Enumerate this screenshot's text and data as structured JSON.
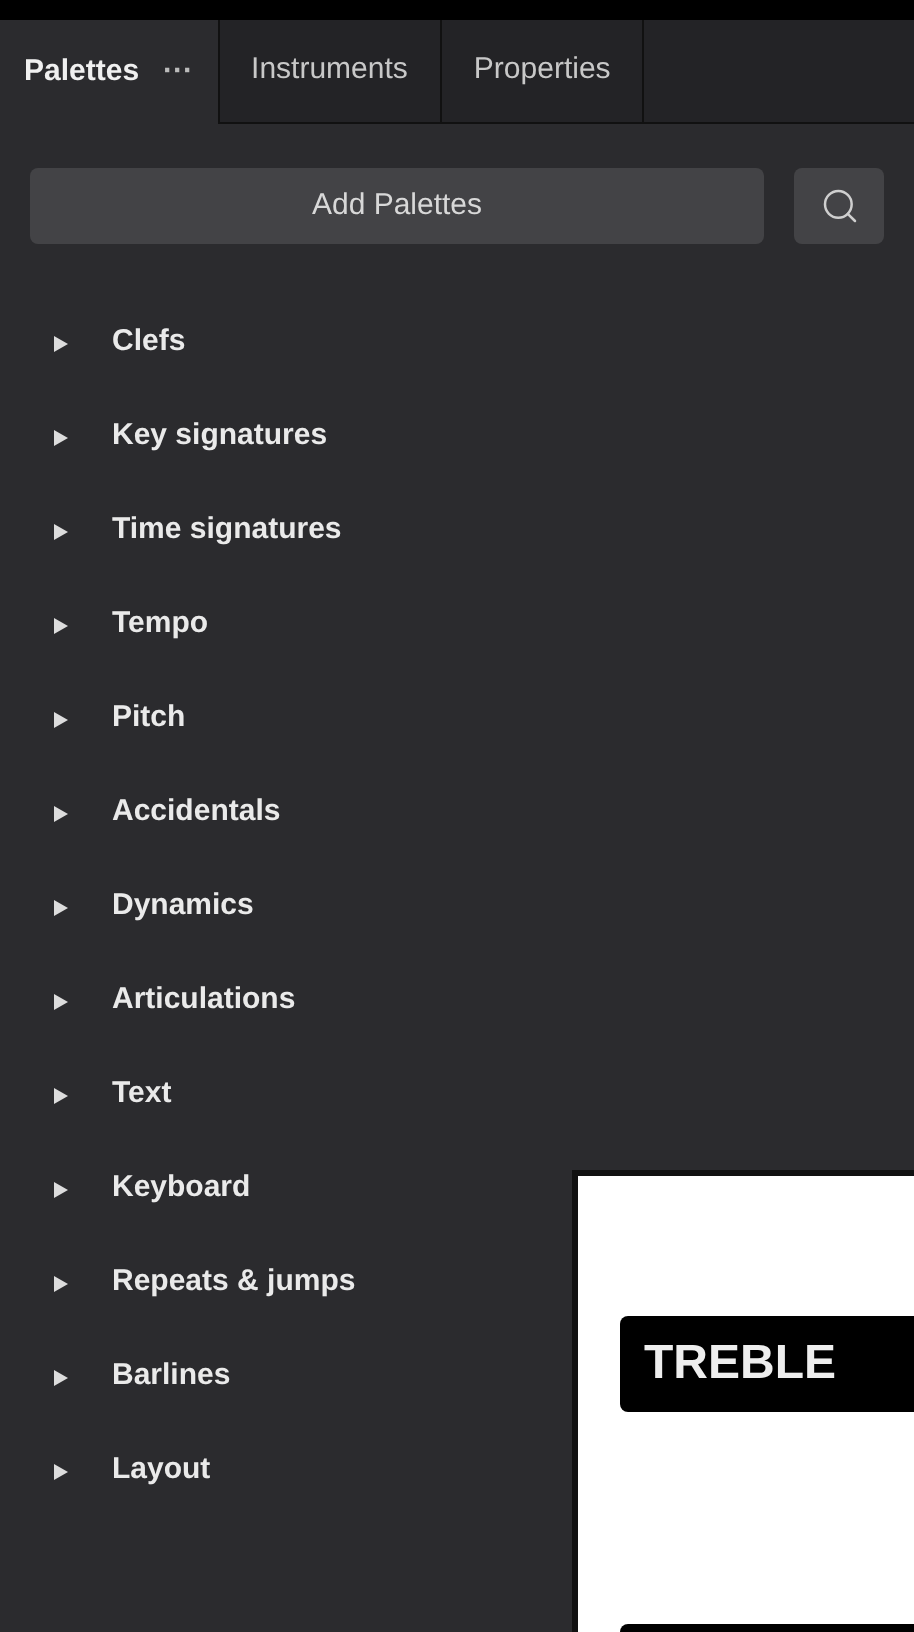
{
  "tabs": [
    {
      "label": "Palettes",
      "menu": "···",
      "selected": true
    },
    {
      "label": "Instruments",
      "selected": false
    },
    {
      "label": "Properties",
      "selected": false
    }
  ],
  "add_button": "Add Palettes",
  "palettes": [
    {
      "label": "Clefs",
      "expanded": false
    },
    {
      "label": "Key signatures",
      "expanded": false
    },
    {
      "label": "Time signatures",
      "expanded": false
    },
    {
      "label": "Tempo",
      "expanded": false
    },
    {
      "label": "Pitch",
      "expanded": false
    },
    {
      "label": "Accidentals",
      "expanded": false
    },
    {
      "label": "Dynamics",
      "expanded": false
    },
    {
      "label": "Articulations",
      "expanded": false
    },
    {
      "label": "Text",
      "expanded": false
    },
    {
      "label": "Keyboard",
      "expanded": false
    },
    {
      "label": "Repeats & jumps",
      "expanded": false
    },
    {
      "label": "Barlines",
      "expanded": false
    },
    {
      "label": "Layout",
      "expanded": false
    }
  ],
  "overlay_card": {
    "label": "TREBLE"
  }
}
